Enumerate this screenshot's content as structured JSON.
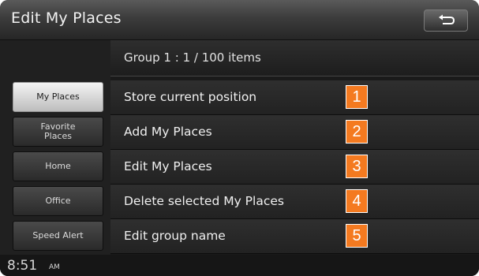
{
  "header": {
    "title": "Edit My Places"
  },
  "group_info": "Group 1 : 1 / 100 items",
  "tabs": [
    {
      "label": "My Places",
      "active": true
    },
    {
      "label": "Favorite Places",
      "active": false
    },
    {
      "label": "Home",
      "active": false
    },
    {
      "label": "Office",
      "active": false
    },
    {
      "label": "Speed Alert",
      "active": false
    }
  ],
  "menu": [
    {
      "label": "Store current position",
      "badge": "1"
    },
    {
      "label": "Add My Places",
      "badge": "2"
    },
    {
      "label": "Edit My Places",
      "badge": "3"
    },
    {
      "label": "Delete selected My Places",
      "badge": "4"
    },
    {
      "label": "Edit group name",
      "badge": "5"
    }
  ],
  "status": {
    "time": "8:51",
    "ampm": "AM"
  },
  "colors": {
    "badge": "#f47a20",
    "active_tab": "#e0e0e0",
    "background": "#1a1a1a"
  },
  "icons": {
    "back": "back-arrow-icon"
  }
}
